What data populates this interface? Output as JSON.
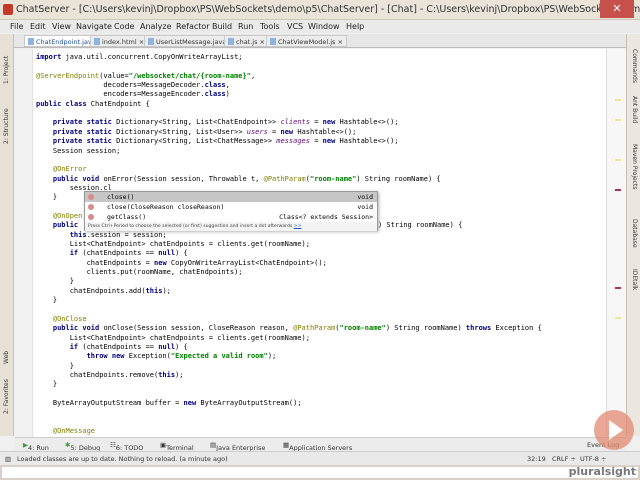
{
  "window": {
    "title": "ChatServer - [C:\\Users\\kevinj\\Dropbox\\PS\\WebSockets\\demo\\p5\\ChatServer] - [Chat] - C:\\Users\\kevinj\\Dropbox\\PS\\WebSockets\\dem...",
    "minimize": "–",
    "maximize": "□",
    "close": "✕"
  },
  "menu": [
    "File",
    "Edit",
    "View",
    "Navigate",
    "Code",
    "Analyze",
    "Refactor",
    "Build",
    "Run",
    "Tools",
    "VCS",
    "Window",
    "Help"
  ],
  "tabs": [
    {
      "label": "ChatEndpoint.java",
      "active": true
    },
    {
      "label": "index.html"
    },
    {
      "label": "UserListMessage.java"
    },
    {
      "label": "chat.js"
    },
    {
      "label": "ChatViewModel.js"
    }
  ],
  "left_tools": [
    "1: Project",
    "2: Structure",
    "Web",
    "2: Favorites"
  ],
  "right_tools": [
    "Commands",
    "Ant Build",
    "Maven Projects",
    "Database",
    "IDEtalk"
  ],
  "code": [
    "import java.util.concurrent.CopyOnWriteArrayList;",
    "",
    "@ServerEndpoint(value=\"/websocket/chat/{room-name}\",",
    "                decoders=MessageDecoder.class,",
    "                encoders=MessageEncoder.class)",
    "public class ChatEndpoint {",
    "",
    "    private static Dictionary<String, List<ChatEndpoint>> clients = new Hashtable<>();",
    "    private static Dictionary<String, List<User>> users = new Hashtable<>();",
    "    private static Dictionary<String, List<ChatMessage>> messages = new Hashtable<>();",
    "    Session session;",
    "",
    "    @OnError",
    "    public void onError(Session session, Throwable t, @PathParam(\"room-name\") String roomName) {",
    "        session.cl",
    "    }",
    "",
    "    @OnOpen",
    "    public",
    "        this.session = session;",
    "        List<ChatEndpoint> chatEndpoints = clients.get(roomName);",
    "        if (chatEndpoints == null) {",
    "            chatEndpoints = new CopyOnWriteArrayList<ChatEndpoint>();",
    "            clients.put(roomName, chatEndpoints);",
    "        }",
    "        chatEndpoints.add(this);",
    "    }",
    "",
    "    @OnClose",
    "    public void onClose(Session session, CloseReason reason, @PathParam(\"room-name\") String roomName) throws Exception {",
    "        List<ChatEndpoint> chatEndpoints = clients.get(roomName);",
    "        if (chatEndpoints == null) {",
    "            throw new Exception(\"Expected a valid room\");",
    "        }",
    "        chatEndpoints.remove(this);",
    "    }",
    "",
    "    ByteArrayOutputStream buffer = new ByteArrayOutputStream();",
    "",
    "",
    "    @OnMessage"
  ],
  "onopen_tail": ") String roomName) {",
  "completion": {
    "items": [
      {
        "name": "close()",
        "type": "void",
        "selected": true
      },
      {
        "name": "close(CloseReason closeReason)",
        "type": "void"
      },
      {
        "name": "getClass()",
        "type": "Class<? extends Session>"
      }
    ],
    "hint": "Press Ctrl+Period to choose the selected (or first) suggestion and insert a dot afterwards",
    "hint_link": ">>"
  },
  "toolwindows": [
    "4: Run",
    "5: Debug",
    "6: TODO",
    "Terminal",
    "Java Enterprise",
    "Application Servers",
    "Event Log"
  ],
  "status": {
    "message": "Loaded classes are up to date. Nothing to reload. (a minute ago)",
    "position": "32:19",
    "line_sep": "CRLF ÷",
    "encoding": "UTF-8 ÷"
  },
  "watermark": "pluralsight"
}
